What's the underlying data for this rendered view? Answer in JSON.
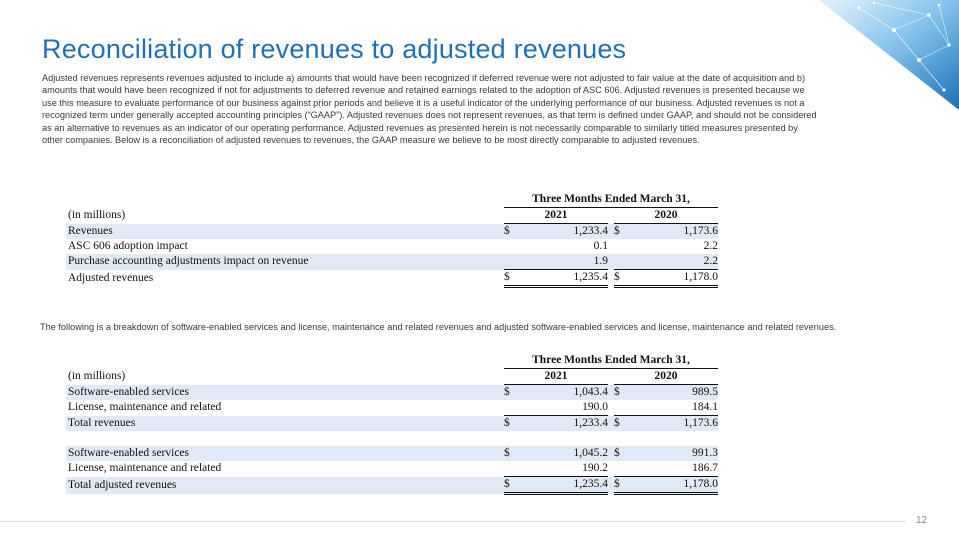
{
  "slide": {
    "title": "Reconciliation of revenues to adjusted revenues",
    "intro": "Adjusted revenues represents revenues adjusted to include a) amounts that would have been recognized if deferred revenue were not adjusted to fair value at the date of acquisition and b) amounts that would have been recognized if not for adjustments to deferred revenue and retained earnings related to the adoption of ASC 606.  Adjusted revenues is presented because we use this measure to evaluate performance of our business against prior periods and believe it is a useful indicator of the underlying performance of our business.  Adjusted revenues is not a recognized term under generally accepted accounting principles (“GAAP”).  Adjusted revenues does not represent revenues, as that term is defined under GAAP, and should not be considered as an alternative to revenues as an indicator of our operating performance.  Adjusted revenues as presented herein is not necessarily comparable to similarly titled measures presented by other companies.  Below is a reconciliation of adjusted revenues to revenues, the GAAP measure we believe to be most directly comparable to adjusted revenues.",
    "breakdown_intro": "The following is a breakdown of software-enabled services and license, maintenance and related revenues and adjusted software-enabled services and license, maintenance and related revenues.",
    "page_number": "12"
  },
  "table1": {
    "period": "Three Months Ended March 31,",
    "units": "(in millions)",
    "year1": "2021",
    "year2": "2020",
    "rows": [
      {
        "label": "Revenues",
        "d1": "$",
        "v1": "1,233.4",
        "d2": "$",
        "v2": "1,173.6"
      },
      {
        "label": "ASC 606 adoption impact",
        "d1": "",
        "v1": "0.1",
        "d2": "",
        "v2": "2.2"
      },
      {
        "label": "Purchase accounting adjustments impact on revenue",
        "d1": "",
        "v1": "1.9",
        "d2": "",
        "v2": "2.2"
      },
      {
        "label": "Adjusted revenues",
        "d1": "$",
        "v1": "1,235.4",
        "d2": "$",
        "v2": "1,178.0"
      }
    ]
  },
  "table2": {
    "period": "Three Months Ended March 31,",
    "units": "(in millions)",
    "year1": "2021",
    "year2": "2020",
    "rows": [
      {
        "label": "Software-enabled services",
        "d1": "$",
        "v1": "1,043.4",
        "d2": "$",
        "v2": "989.5"
      },
      {
        "label": "License, maintenance and related",
        "d1": "",
        "v1": "190.0",
        "d2": "",
        "v2": "184.1"
      },
      {
        "label": "Total revenues",
        "d1": "$",
        "v1": "1,233.4",
        "d2": "$",
        "v2": "1,173.6"
      },
      {
        "label": "Software-enabled services",
        "d1": "$",
        "v1": "1,045.2",
        "d2": "$",
        "v2": "991.3"
      },
      {
        "label": "License, maintenance and related",
        "d1": "",
        "v1": "190.2",
        "d2": "",
        "v2": "186.7"
      },
      {
        "label": "Total adjusted revenues",
        "d1": "$",
        "v1": "1,235.4",
        "d2": "$",
        "v2": "1,178.0"
      }
    ]
  },
  "colors": {
    "title": "#1f6fbd",
    "row_band": "#dfeaf6"
  },
  "icons": {
    "corner": "network-graphic-icon"
  }
}
